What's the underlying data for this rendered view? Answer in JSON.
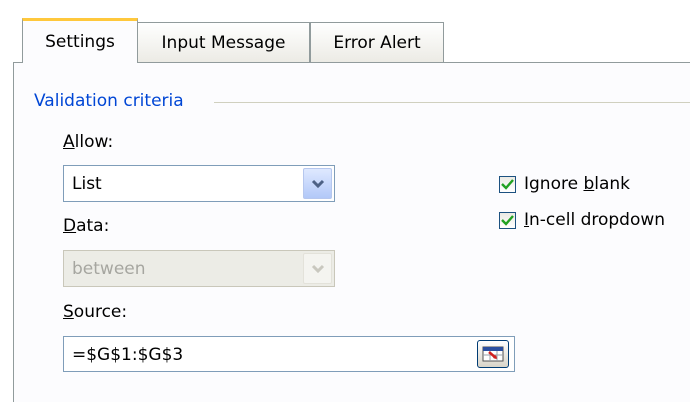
{
  "tabs": [
    {
      "label": "Settings",
      "active": true
    },
    {
      "label": "Input Message",
      "active": false
    },
    {
      "label": "Error Alert",
      "active": false
    }
  ],
  "group": {
    "title": "Validation criteria"
  },
  "allow": {
    "label_key": "A",
    "label_rest": "llow:",
    "value": "List"
  },
  "data": {
    "label_key": "D",
    "label_rest": "ata:",
    "value": "between"
  },
  "source": {
    "label_key": "S",
    "label_rest": "ource:",
    "value": "=$G$1:$G$3"
  },
  "checkboxes": {
    "ignore_blank": {
      "pre": "Ignore ",
      "key": "b",
      "post": "lank",
      "checked": true
    },
    "in_cell": {
      "pre": "",
      "key": "I",
      "post": "n-cell dropdown",
      "checked": true
    }
  },
  "icons": {
    "dropdown": "chevron-down-icon",
    "collapse": "collapse-dialog-icon",
    "check": "checkmark-icon"
  },
  "colors": {
    "accent_tab": "#ffc83c",
    "group_title": "#0046d5",
    "check": "#21a121"
  }
}
